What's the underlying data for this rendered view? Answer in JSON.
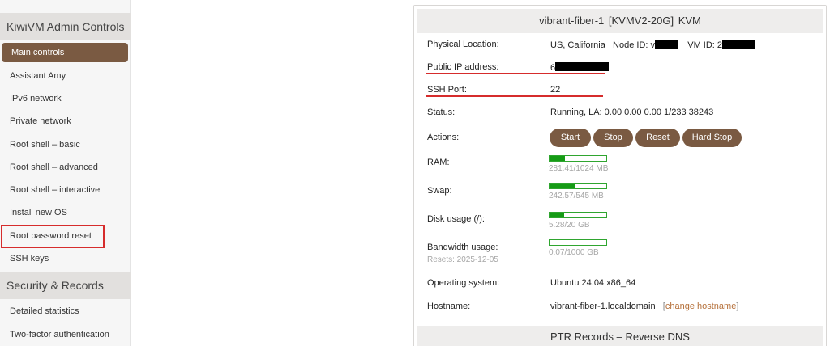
{
  "sidebar": {
    "section1": "KiwiVM Admin Controls",
    "items": [
      {
        "label": "Main controls"
      },
      {
        "label": "Assistant Amy"
      },
      {
        "label": "IPv6 network"
      },
      {
        "label": "Private network"
      },
      {
        "label": "Root shell – basic"
      },
      {
        "label": "Root shell – advanced"
      },
      {
        "label": "Root shell – interactive"
      },
      {
        "label": "Install new OS"
      },
      {
        "label": "Root password reset"
      },
      {
        "label": "SSH keys"
      }
    ],
    "section2": "Security & Records",
    "items2": [
      {
        "label": "Detailed statistics"
      },
      {
        "label": "Two-factor authentication"
      }
    ]
  },
  "vm": {
    "header": "vibrant-fiber-1 [KVMV2-20G] KVM",
    "location_label": "Physical Location:",
    "location_value": "US, California",
    "node_id_label": "Node ID: v",
    "vm_id_label": "VM ID: 2",
    "ip_label": "Public IP address:",
    "ip_prefix": "6",
    "ssh_label": "SSH Port:",
    "ssh_value": "22",
    "status_label": "Status:",
    "status_value": "Running, LA: 0.00 0.00 0.00 1/233 38243",
    "actions_label": "Actions:",
    "actions": {
      "start": "Start",
      "stop": "Stop",
      "reset": "Reset",
      "hard_stop": "Hard Stop"
    },
    "ram_label": "RAM:",
    "ram_text": "281.41/1024 MB",
    "ram_fraction": 0.275,
    "swap_label": "Swap:",
    "swap_text": "242.57/545 MB",
    "swap_fraction": 0.445,
    "disk_label": "Disk usage (/):",
    "disk_text": "5.28/20 GB",
    "disk_fraction": 0.264,
    "bw_label": "Bandwidth usage:",
    "bw_resets": "Resets: 2025-12-05",
    "bw_text": "0.07/1000 GB",
    "bw_fraction": 0.0,
    "os_label": "Operating system:",
    "os_value": "Ubuntu 24.04 x86_64",
    "hostname_label": "Hostname:",
    "hostname_value": "vibrant-fiber-1.localdomain",
    "change_hostname": "change hostname"
  },
  "ptr": {
    "header": "PTR Records – Reverse DNS"
  },
  "colors": {
    "accent": "#7a5a42",
    "highlight": "#d62c2c",
    "bar_fill": "#159b15",
    "link": "#b5703a"
  }
}
